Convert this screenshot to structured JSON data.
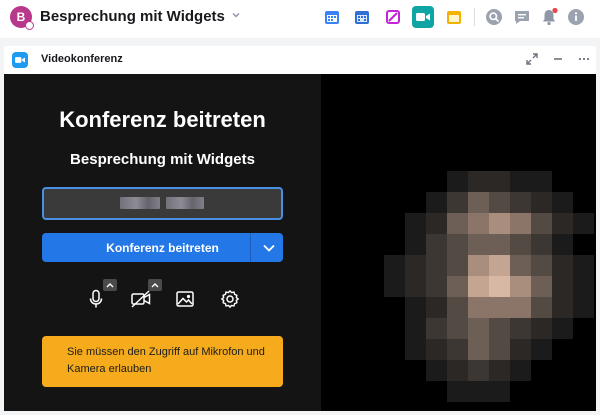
{
  "room": {
    "avatar_letter": "B",
    "name": "Besprechung mit Widgets"
  },
  "header_icons": [
    {
      "name": "calendar-icon",
      "color": "#3b82f6"
    },
    {
      "name": "calendar-grid-icon",
      "color": "#3b82f6"
    },
    {
      "name": "whiteboard-icon",
      "color": "#c026d3"
    },
    {
      "name": "video-camera-icon",
      "color": "#0ea5a4"
    },
    {
      "name": "window-icon",
      "color": "#f5b100"
    },
    {
      "name": "search-icon",
      "color": "#8d97a5"
    },
    {
      "name": "threads-icon",
      "color": "#8d97a5"
    },
    {
      "name": "bell-icon",
      "color": "#8d97a5"
    },
    {
      "name": "info-icon",
      "color": "#8d97a5"
    }
  ],
  "widget": {
    "title": "Videokonferenz"
  },
  "conference": {
    "heading": "Konferenz beitreten",
    "room_name": "Besprechung mit Widgets",
    "join_label": "Konferenz beitreten",
    "warning": "Sie müssen den Zugriff auf Mikrofon und Kamera erlauben"
  },
  "colors": {
    "accent": "#2477e6",
    "warning": "#f5ab1b",
    "notification": "#e5484d"
  }
}
